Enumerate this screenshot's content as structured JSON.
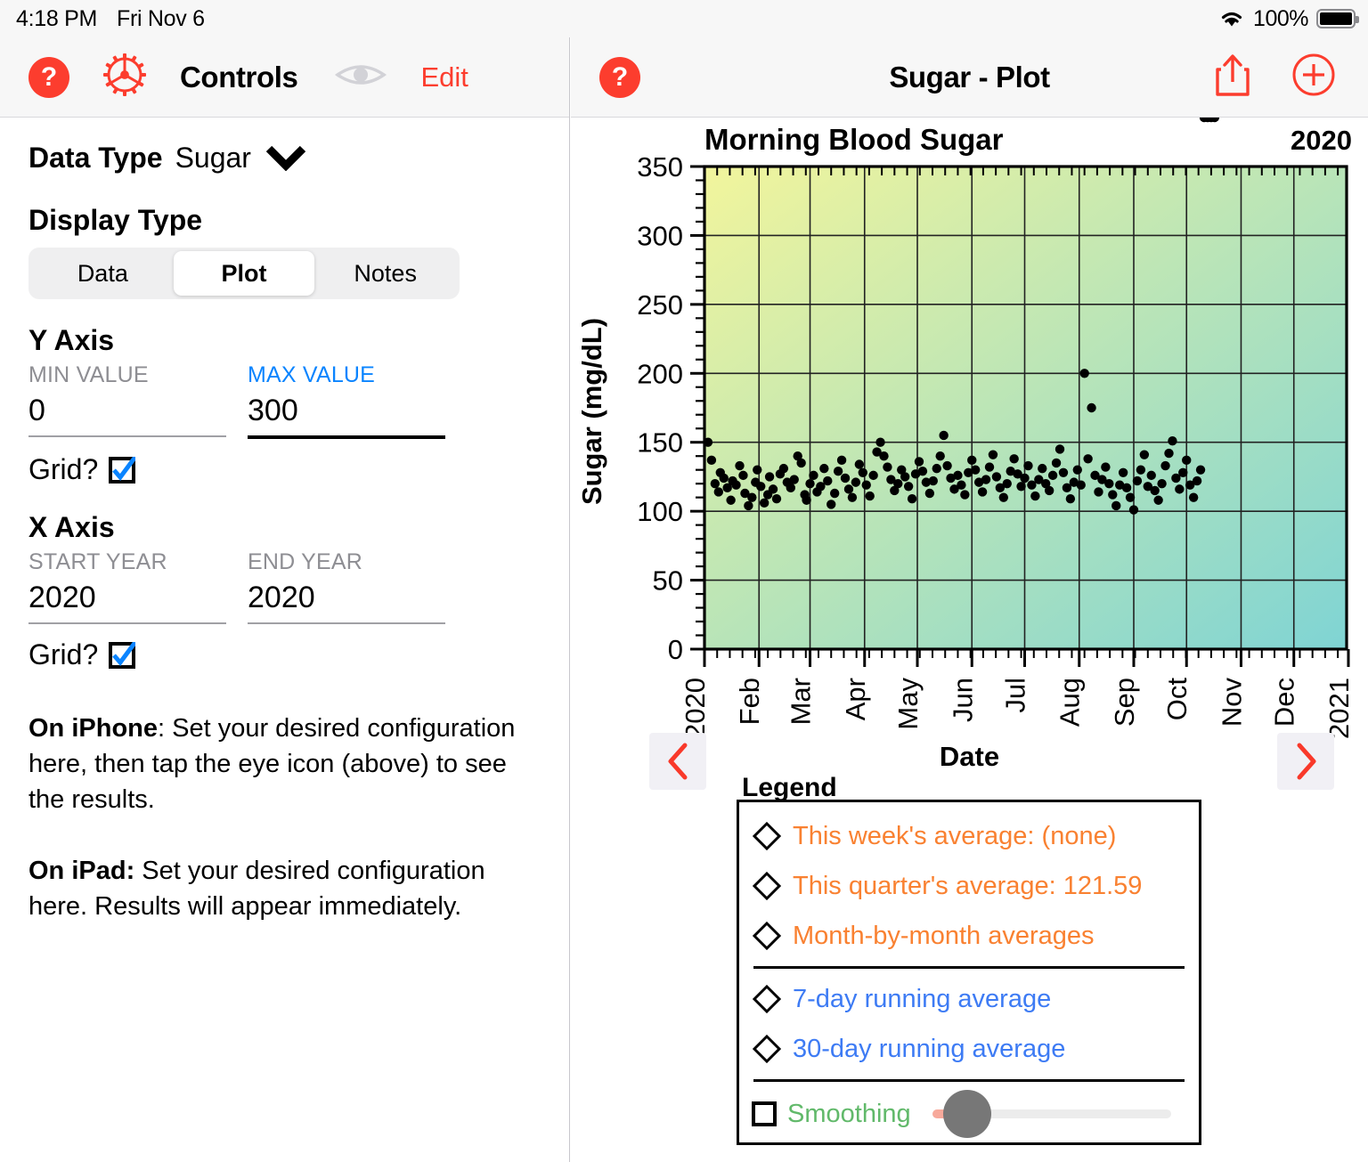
{
  "status_bar": {
    "time": "4:18 PM",
    "date": "Fri Nov 6",
    "battery_percent": "100%",
    "wifi_icon": "wifi-icon",
    "battery_icon": "battery-full-icon"
  },
  "left_pane": {
    "navbar": {
      "help_label": "?",
      "gear_icon": "gear-icon",
      "title": "Controls",
      "eye_icon": "eye-icon",
      "edit_label": "Edit"
    },
    "data_type": {
      "label": "Data Type",
      "value": "Sugar",
      "chevron_icon": "chevron-down-icon"
    },
    "display_type": {
      "label": "Display Type",
      "options": [
        "Data",
        "Plot",
        "Notes"
      ],
      "selected": "Plot"
    },
    "y_axis": {
      "title": "Y Axis",
      "min_label": "MIN VALUE",
      "min_value": "0",
      "max_label": "MAX VALUE",
      "max_value": "300",
      "max_focused": true,
      "grid_label": "Grid?",
      "grid_checked": true
    },
    "x_axis": {
      "title": "X Axis",
      "start_label": "START YEAR",
      "start_value": "2020",
      "end_label": "END YEAR",
      "end_value": "2020",
      "grid_label": "Grid?",
      "grid_checked": true
    },
    "help": {
      "iphone_bold": "On iPhone",
      "iphone_text": ": Set your desired configuration here, then tap the eye icon (above) to see the results.",
      "ipad_bold": "On iPad:",
      "ipad_text": " Set your desired configuration here. Results will appear immediately."
    }
  },
  "right_pane": {
    "navbar": {
      "help_label": "?",
      "title": "Sugar - Plot",
      "share_icon": "share-icon",
      "add_icon": "plus-circle-icon"
    },
    "nav_prev_icon": "chevron-left-icon",
    "nav_next_icon": "chevron-right-icon",
    "legend": {
      "title": "Legend",
      "items": [
        {
          "marker": "diamond-icon",
          "label": "This week's average: (none)",
          "color": "#f98131"
        },
        {
          "marker": "diamond-icon",
          "label": "This quarter's average: 121.59",
          "color": "#f98131"
        },
        {
          "marker": "diamond-icon",
          "label": "Month-by-month averages",
          "color": "#f98131"
        },
        {
          "marker": "diamond-icon",
          "label": "7-day running average",
          "color": "#3d7bf4"
        },
        {
          "marker": "diamond-icon",
          "label": "30-day running average",
          "color": "#3d7bf4"
        }
      ],
      "smoothing": {
        "label": "Smoothing",
        "checked": false,
        "color": "#61b96a",
        "slider_value": 4
      }
    }
  },
  "chart_data": {
    "type": "scatter",
    "title": "Morning Blood Sugar",
    "corner_label": "2020",
    "xlabel": "Date",
    "ylabel": "Sugar (mg/dL)",
    "ylim": [
      0,
      350
    ],
    "yticks": [
      0,
      50,
      100,
      150,
      200,
      250,
      300,
      350
    ],
    "xticks": [
      "2020",
      "Feb",
      "Mar",
      "Apr",
      "May",
      "Jun",
      "Jul",
      "Aug",
      "Sep",
      "Oct",
      "Nov",
      "Dec",
      "2021"
    ],
    "grid": true,
    "background_gradient": [
      "#f2f59c",
      "#7fd4d4"
    ],
    "point_color": "#000000",
    "series": [
      {
        "name": "Morning Blood Sugar",
        "x": [
          2,
          4,
          6,
          8,
          9,
          11,
          13,
          15,
          16,
          18,
          20,
          22,
          23,
          25,
          27,
          29,
          30,
          32,
          34,
          36,
          37,
          39,
          41,
          43,
          45,
          47,
          49,
          51,
          53,
          55,
          57,
          58,
          60,
          62,
          64,
          66,
          68,
          70,
          72,
          74,
          76,
          78,
          80,
          82,
          84,
          86,
          88,
          90,
          92,
          94,
          96,
          98,
          100,
          102,
          104,
          106,
          108,
          110,
          112,
          114,
          116,
          118,
          120,
          122,
          124,
          126,
          128,
          130,
          132,
          134,
          136,
          138,
          140,
          142,
          144,
          146,
          148,
          150,
          152,
          154,
          156,
          158,
          160,
          162,
          164,
          166,
          168,
          170,
          172,
          174,
          176,
          178,
          180,
          182,
          184,
          186,
          188,
          190,
          192,
          194,
          196,
          198,
          200,
          202,
          204,
          206,
          208,
          210,
          212,
          214,
          216,
          218,
          220,
          222,
          224,
          226,
          228,
          230,
          232,
          234,
          236,
          238,
          240,
          242,
          244,
          246,
          248,
          250,
          252,
          254,
          256,
          258,
          260,
          262,
          264,
          266,
          268,
          270,
          272,
          274,
          276,
          278,
          280,
          282,
          284,
          286,
          288,
          290
        ],
        "y": [
          150,
          137,
          120,
          114,
          128,
          124,
          117,
          108,
          122,
          119,
          133,
          126,
          113,
          104,
          110,
          121,
          130,
          118,
          106,
          112,
          125,
          116,
          109,
          127,
          131,
          121,
          117,
          123,
          140,
          135,
          112,
          108,
          120,
          126,
          114,
          118,
          131,
          122,
          105,
          113,
          129,
          137,
          124,
          116,
          110,
          121,
          134,
          128,
          119,
          111,
          126,
          143,
          150,
          140,
          132,
          123,
          115,
          120,
          130,
          125,
          118,
          109,
          127,
          136,
          129,
          121,
          113,
          122,
          131,
          140,
          155,
          133,
          124,
          116,
          126,
          119,
          112,
          128,
          137,
          130,
          121,
          114,
          123,
          132,
          141,
          125,
          117,
          110,
          120,
          129,
          138,
          127,
          118,
          124,
          133,
          119,
          111,
          123,
          131,
          120,
          115,
          126,
          135,
          145,
          128,
          117,
          109,
          121,
          130,
          119,
          200,
          138,
          175,
          126,
          114,
          123,
          132,
          120,
          112,
          104,
          119,
          128,
          117,
          110,
          101,
          122,
          130,
          141,
          118,
          126,
          115,
          108,
          120,
          133,
          142,
          151,
          124,
          116,
          128,
          137,
          119,
          110,
          122,
          130
        ]
      }
    ]
  }
}
